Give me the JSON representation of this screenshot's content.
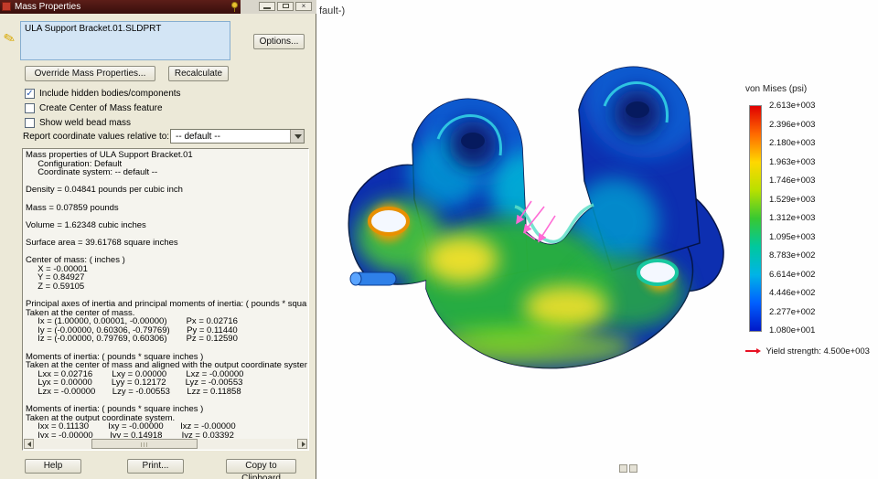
{
  "dialog": {
    "title": "Mass Properties",
    "selection": "ULA Support Bracket.01.SLDPRT",
    "options_button": "Options...",
    "override_button": "Override Mass Properties...",
    "recalculate_button": "Recalculate",
    "checkboxes": [
      {
        "label": "Include hidden bodies/components",
        "checked": true
      },
      {
        "label": "Create Center of Mass feature",
        "checked": false
      },
      {
        "label": "Show weld bead mass",
        "checked": false
      }
    ],
    "report_label": "Report coordinate values relative to:",
    "report_value": "-- default --",
    "results_text": "Mass properties of ULA Support Bracket.01\n     Configuration: Default\n     Coordinate system: -- default --\n\nDensity = 0.04841 pounds per cubic inch\n\nMass = 0.07859 pounds\n\nVolume = 1.62348 cubic inches\n\nSurface area = 39.61768 square inches\n\nCenter of mass: ( inches )\n     X = -0.00001\n     Y = 0.84927\n     Z = 0.59105\n\nPrincipal axes of inertia and principal moments of inertia: ( pounds * square inches )\nTaken at the center of mass.\n     Ix = (1.00000, 0.00001, -0.00000)        Px = 0.02716\n     Iy = (-0.00000, 0.60306, -0.79769)       Py = 0.11440\n     Iz = (-0.00000, 0.79769, 0.60306)        Pz = 0.12590\n\nMoments of inertia: ( pounds * square inches )\nTaken at the center of mass and aligned with the output coordinate system.\n     Lxx = 0.02716        Lxy = 0.00000        Lxz = -0.00000\n     Lyx = 0.00000        Lyy = 0.12172        Lyz = -0.00553\n     Lzx = -0.00000       Lzy = -0.00553       Lzz = 0.11858\n\nMoments of inertia: ( pounds * square inches )\nTaken at the output coordinate system.\n     Ixx = 0.11130        Ixy = -0.00000       Ixz = -0.00000\n     Iyx = -0.00000       Iyy = 0.14918        Iyz = 0.03392",
    "help_button": "Help",
    "print_button": "Print...",
    "copy_button": "Copy to Clipboard"
  },
  "window_controls": {
    "close": "×"
  },
  "icons": {
    "annotate_pencil": "✎"
  },
  "viewport": {
    "doc_title_fragment": "fault-)",
    "legend": {
      "title": "von Mises (psi)",
      "labels": [
        "2.613e+003",
        "2.396e+003",
        "2.180e+003",
        "1.963e+003",
        "1.746e+003",
        "1.529e+003",
        "1.312e+003",
        "1.095e+003",
        "8.783e+002",
        "6.614e+002",
        "4.446e+002",
        "2.277e+002",
        "1.080e+001"
      ],
      "gradient_colors": [
        "#e00000",
        "#ff6a00",
        "#ffd800",
        "#b8e000",
        "#38c832",
        "#00c89e",
        "#00b4e6",
        "#0060ff",
        "#0018c8"
      ],
      "yield_label": "Yield strength: 4.500e+003",
      "yield_color": "#e81123"
    }
  }
}
